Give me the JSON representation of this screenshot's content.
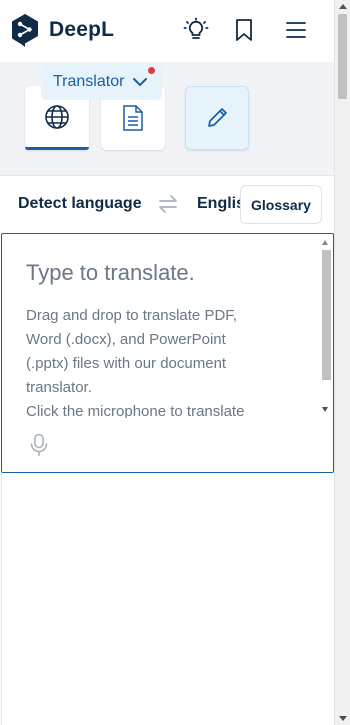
{
  "header": {
    "brand": "DeepL",
    "icons": {
      "logo": "deepl-logo-icon",
      "tips": "lightbulb-icon",
      "saved": "bookmark-icon",
      "menu": "hamburger-menu-icon"
    }
  },
  "modes": {
    "selected_label": "Translator",
    "items": [
      {
        "name": "text-translation",
        "icon": "globe-icon",
        "active": true
      },
      {
        "name": "document-translation",
        "icon": "document-icon",
        "active": false
      },
      {
        "name": "write",
        "icon": "pencil-icon",
        "active": false
      }
    ]
  },
  "languages": {
    "source": "Detect language",
    "target": "English (US)",
    "swap_icon": "swap-arrows-icon",
    "glossary_label": "Glossary"
  },
  "source_input": {
    "placeholder": "Type to translate.",
    "hint_lines": [
      "Drag and drop to translate PDF,",
      "Word (.docx), and PowerPoint",
      "(.pptx) files with our document",
      "translator.",
      "Click the microphone to translate"
    ],
    "mic_icon": "microphone-icon"
  },
  "colors": {
    "brand_navy": "#0f2b46",
    "accent_blue": "#1a5fa3",
    "pill_bg": "#e6f3fa",
    "notification_red": "#e5373e"
  }
}
